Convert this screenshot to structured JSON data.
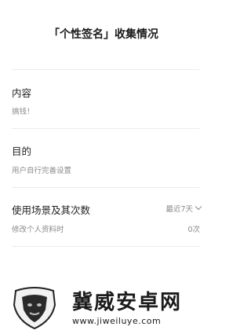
{
  "page": {
    "title": "「个性签名」收集情况"
  },
  "sections": {
    "content": {
      "label": "内容",
      "value": "搞钱！"
    },
    "purpose": {
      "label": "目的",
      "value": "用户自行完善设置"
    },
    "usage": {
      "label": "使用场景及其次数",
      "filter": "最近7天",
      "scene": "修改个人资料时",
      "count": "0次"
    }
  },
  "watermark": {
    "text": "冀威安卓网",
    "url": "www.jiweiluye.com"
  },
  "colors": {
    "text": "#1f1f1f",
    "muted": "#8a8a8a",
    "divider": "#ececec"
  }
}
